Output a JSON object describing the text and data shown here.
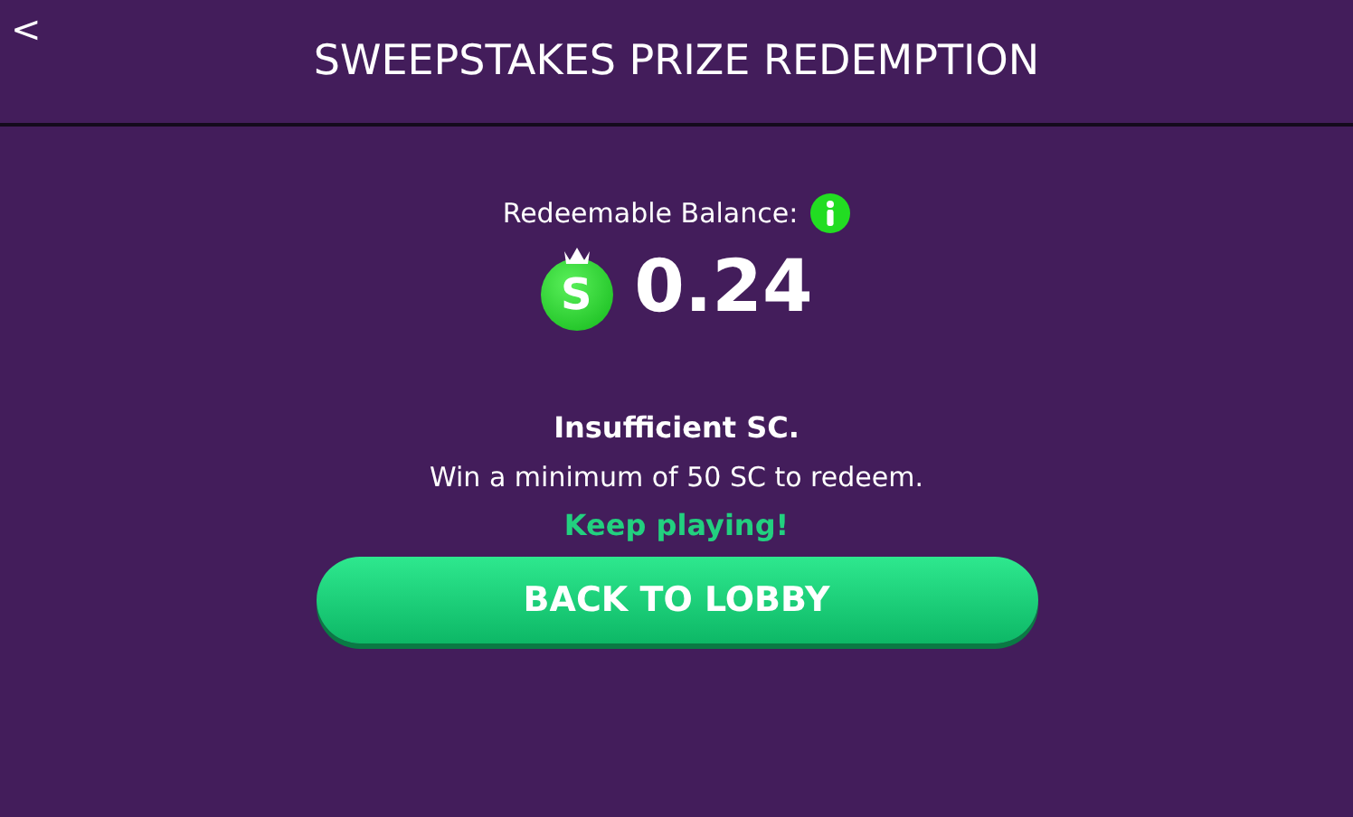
{
  "header": {
    "back": "<",
    "title": "SWEEPSTAKES PRIZE REDEMPTION"
  },
  "balance": {
    "label": "Redeemable Balance:",
    "coin_letter": "S",
    "amount": "0.24"
  },
  "message": {
    "heading": "Insufficient SC.",
    "body": "Win a minimum of 50 SC to redeem.",
    "encouragement": "Keep playing!"
  },
  "button": "BACK TO LOBBY"
}
